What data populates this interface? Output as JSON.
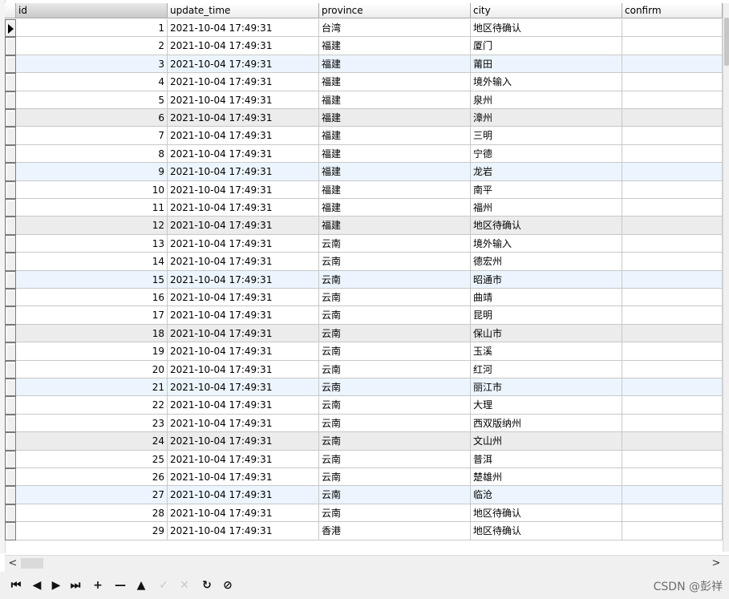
{
  "columns": [
    "id",
    "update_time",
    "province",
    "city",
    "confirm"
  ],
  "rows": [
    {
      "id": "1",
      "update_time": "2021-10-04 17:49:31",
      "province": "台湾",
      "city": "地区待确认",
      "confirm": ""
    },
    {
      "id": "2",
      "update_time": "2021-10-04 17:49:31",
      "province": "福建",
      "city": "厦门",
      "confirm": ""
    },
    {
      "id": "3",
      "update_time": "2021-10-04 17:49:31",
      "province": "福建",
      "city": "莆田",
      "confirm": ""
    },
    {
      "id": "4",
      "update_time": "2021-10-04 17:49:31",
      "province": "福建",
      "city": "境外输入",
      "confirm": ""
    },
    {
      "id": "5",
      "update_time": "2021-10-04 17:49:31",
      "province": "福建",
      "city": "泉州",
      "confirm": ""
    },
    {
      "id": "6",
      "update_time": "2021-10-04 17:49:31",
      "province": "福建",
      "city": "漳州",
      "confirm": ""
    },
    {
      "id": "7",
      "update_time": "2021-10-04 17:49:31",
      "province": "福建",
      "city": "三明",
      "confirm": ""
    },
    {
      "id": "8",
      "update_time": "2021-10-04 17:49:31",
      "province": "福建",
      "city": "宁德",
      "confirm": ""
    },
    {
      "id": "9",
      "update_time": "2021-10-04 17:49:31",
      "province": "福建",
      "city": "龙岩",
      "confirm": ""
    },
    {
      "id": "10",
      "update_time": "2021-10-04 17:49:31",
      "province": "福建",
      "city": "南平",
      "confirm": ""
    },
    {
      "id": "11",
      "update_time": "2021-10-04 17:49:31",
      "province": "福建",
      "city": "福州",
      "confirm": ""
    },
    {
      "id": "12",
      "update_time": "2021-10-04 17:49:31",
      "province": "福建",
      "city": "地区待确认",
      "confirm": ""
    },
    {
      "id": "13",
      "update_time": "2021-10-04 17:49:31",
      "province": "云南",
      "city": "境外输入",
      "confirm": ""
    },
    {
      "id": "14",
      "update_time": "2021-10-04 17:49:31",
      "province": "云南",
      "city": "德宏州",
      "confirm": ""
    },
    {
      "id": "15",
      "update_time": "2021-10-04 17:49:31",
      "province": "云南",
      "city": "昭通市",
      "confirm": ""
    },
    {
      "id": "16",
      "update_time": "2021-10-04 17:49:31",
      "province": "云南",
      "city": "曲靖",
      "confirm": ""
    },
    {
      "id": "17",
      "update_time": "2021-10-04 17:49:31",
      "province": "云南",
      "city": "昆明",
      "confirm": ""
    },
    {
      "id": "18",
      "update_time": "2021-10-04 17:49:31",
      "province": "云南",
      "city": "保山市",
      "confirm": ""
    },
    {
      "id": "19",
      "update_time": "2021-10-04 17:49:31",
      "province": "云南",
      "city": "玉溪",
      "confirm": ""
    },
    {
      "id": "20",
      "update_time": "2021-10-04 17:49:31",
      "province": "云南",
      "city": "红河",
      "confirm": ""
    },
    {
      "id": "21",
      "update_time": "2021-10-04 17:49:31",
      "province": "云南",
      "city": "丽江市",
      "confirm": ""
    },
    {
      "id": "22",
      "update_time": "2021-10-04 17:49:31",
      "province": "云南",
      "city": "大理",
      "confirm": ""
    },
    {
      "id": "23",
      "update_time": "2021-10-04 17:49:31",
      "province": "云南",
      "city": "西双版纳州",
      "confirm": ""
    },
    {
      "id": "24",
      "update_time": "2021-10-04 17:49:31",
      "province": "云南",
      "city": "文山州",
      "confirm": ""
    },
    {
      "id": "25",
      "update_time": "2021-10-04 17:49:31",
      "province": "云南",
      "city": "普洱",
      "confirm": ""
    },
    {
      "id": "26",
      "update_time": "2021-10-04 17:49:31",
      "province": "云南",
      "city": "楚雄州",
      "confirm": ""
    },
    {
      "id": "27",
      "update_time": "2021-10-04 17:49:31",
      "province": "云南",
      "city": "临沧",
      "confirm": ""
    },
    {
      "id": "28",
      "update_time": "2021-10-04 17:49:31",
      "province": "云南",
      "city": "地区待确认",
      "confirm": ""
    },
    {
      "id": "29",
      "update_time": "2021-10-04 17:49:31",
      "province": "香港",
      "city": "地区待确认",
      "confirm": ""
    }
  ],
  "row_colors": {
    "white": "#ffffff",
    "blue": "#ecf5fd",
    "gray": "#ececec"
  },
  "selected_row_index": 0,
  "scrollbar": {
    "left_arrow": "<",
    "right_arrow": ">"
  },
  "toolbar": {
    "buttons": [
      {
        "name": "first-record-icon",
        "glyph": "⏮",
        "enabled": true
      },
      {
        "name": "prev-record-icon",
        "glyph": "◀",
        "enabled": true
      },
      {
        "name": "next-record-icon",
        "glyph": "▶",
        "enabled": true
      },
      {
        "name": "last-record-icon",
        "glyph": "⏭",
        "enabled": true
      },
      {
        "name": "add-record-icon",
        "glyph": "+",
        "enabled": true
      },
      {
        "name": "delete-record-icon",
        "glyph": "—",
        "enabled": true
      },
      {
        "name": "edit-record-icon",
        "glyph": "▲",
        "enabled": true
      },
      {
        "name": "apply-changes-icon",
        "glyph": "✓",
        "enabled": false
      },
      {
        "name": "cancel-changes-icon",
        "glyph": "✕",
        "enabled": false
      },
      {
        "name": "refresh-icon",
        "glyph": "↻",
        "enabled": true
      },
      {
        "name": "stop-icon",
        "glyph": "⊘",
        "enabled": true
      }
    ]
  },
  "watermark": "CSDN @彭祥"
}
